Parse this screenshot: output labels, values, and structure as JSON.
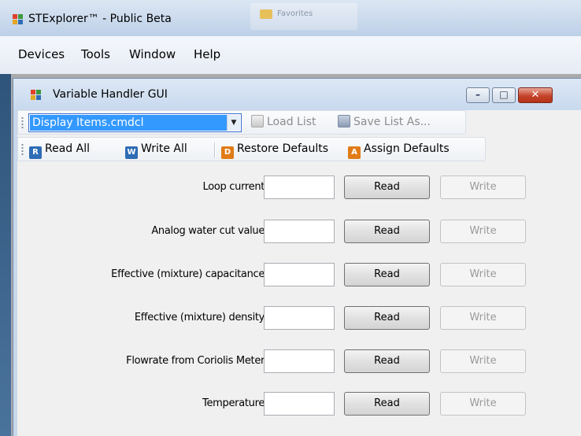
{
  "app": {
    "title": "STExplorer™ - Public Beta",
    "background_tab": "Favorites"
  },
  "menu": [
    "Devices",
    "Tools",
    "Window",
    "Help"
  ],
  "child": {
    "title": "Variable Handler GUI",
    "controls": {
      "minimize": "–",
      "maximize": "□",
      "close": "✕"
    }
  },
  "toolbar1": {
    "selected_list": "Display Items.cmdcl",
    "load_list": "Load List",
    "save_list_as": "Save List As..."
  },
  "toolbar2": {
    "read_all": "Read All",
    "write_all": "Write All",
    "restore_defaults": "Restore Defaults",
    "assign_defaults": "Assign Defaults",
    "icons": {
      "read_all": "R",
      "write_all": "W",
      "restore_defaults": "D",
      "assign_defaults": "A"
    }
  },
  "variables": [
    {
      "label": "Loop current :",
      "value": "",
      "read": "Read",
      "write": "Write"
    },
    {
      "label": "Analog water cut value :",
      "value": "",
      "read": "Read",
      "write": "Write"
    },
    {
      "label": "Effective (mixture) capacitance :",
      "value": "",
      "read": "Read",
      "write": "Write"
    },
    {
      "label": "Effective (mixture) density :",
      "value": "",
      "read": "Read",
      "write": "Write"
    },
    {
      "label": "Flowrate from Coriolis Meter :",
      "value": "",
      "read": "Read",
      "write": "Write"
    },
    {
      "label": "Temperature :",
      "value": "",
      "read": "Read",
      "write": "Write"
    }
  ],
  "colors": {
    "selection": "#3399ff",
    "close_button": "#c4442b",
    "icon_blue": "#2f6db5",
    "icon_orange": "#e07b17"
  }
}
